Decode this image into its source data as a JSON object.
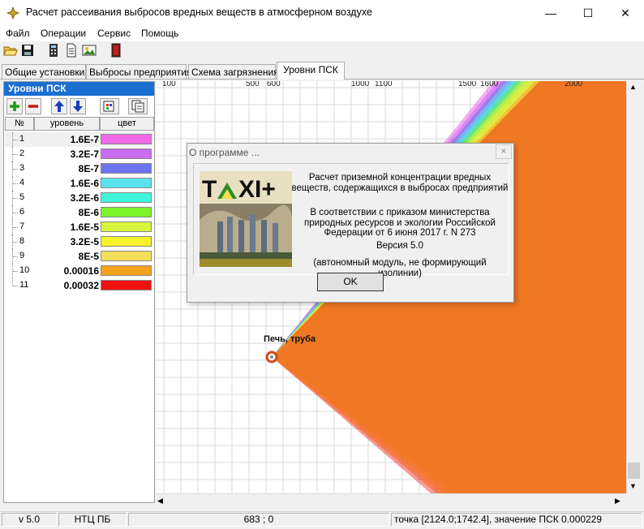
{
  "window": {
    "title": "Расчет рассеивания выбросов вредных веществ в атмосферном воздухе",
    "controls": [
      "—",
      "☐",
      "✕"
    ]
  },
  "menu": [
    "Файл",
    "Операции",
    "Сервис",
    "Помощь"
  ],
  "toolbar_icons": [
    "open-folder-icon",
    "save-disk-icon",
    "calculator-icon",
    "document-icon",
    "image-icon",
    "exit-door-icon"
  ],
  "tabs": [
    {
      "label": "Общие установки",
      "active": false
    },
    {
      "label": "Выбросы предприятия",
      "active": false
    },
    {
      "label": "Схема загрязнения",
      "active": false
    },
    {
      "label": "Уровни ПСК",
      "active": true
    }
  ],
  "panel": {
    "title": "Уровни ПСК",
    "buttons": [
      "plus-icon",
      "minus-icon",
      "arrow-up-icon",
      "arrow-down-icon",
      "palette-icon",
      "copy-icon"
    ],
    "columns": {
      "num": "№",
      "level": "уровень",
      "color": "цвет"
    },
    "levels": [
      {
        "n": "1",
        "value": "1.6E-7",
        "color": "#f06ae8"
      },
      {
        "n": "2",
        "value": "3.2E-7",
        "color": "#c86cf0"
      },
      {
        "n": "3",
        "value": "8E-7",
        "color": "#6e73ef"
      },
      {
        "n": "4",
        "value": "1.6E-6",
        "color": "#5be2ee"
      },
      {
        "n": "5",
        "value": "3.2E-6",
        "color": "#3ff5d9"
      },
      {
        "n": "6",
        "value": "8E-6",
        "color": "#7cf32b"
      },
      {
        "n": "7",
        "value": "1.6E-5",
        "color": "#d8f53d"
      },
      {
        "n": "8",
        "value": "3.2E-5",
        "color": "#f5f328"
      },
      {
        "n": "9",
        "value": "8E-5",
        "color": "#f5df5a"
      },
      {
        "n": "10",
        "value": "0.00016",
        "color": "#f5a21f"
      },
      {
        "n": "11",
        "value": "0.00032",
        "color": "#f01010"
      }
    ]
  },
  "map": {
    "axis_ticks": [
      "100",
      "500",
      "600",
      "1000",
      "1100",
      "1500",
      "1600",
      "2000"
    ],
    "source_label": "Печь, труба"
  },
  "dialog": {
    "title": "О программе ...",
    "logo_text": "TAXI+",
    "line1": "Расчет приземной концентрации вредных веществ, содержащихся в выбросах предприятий",
    "line2": "В соответствии с приказом министерства природных ресурсов и экологии Российской Федерации от 6 июня 2017 г. N 273",
    "version": "Версия 5.0",
    "note": "(автономный модуль, не формирующий изолинии)",
    "ok_label": "OK",
    "close_glyph": "×"
  },
  "status": {
    "version": "v 5.0",
    "org": "НТЦ ПБ",
    "coords": "683 ; 0",
    "point_info": "точка [2124.0;1742.4], значение ПСК 0.000229"
  }
}
